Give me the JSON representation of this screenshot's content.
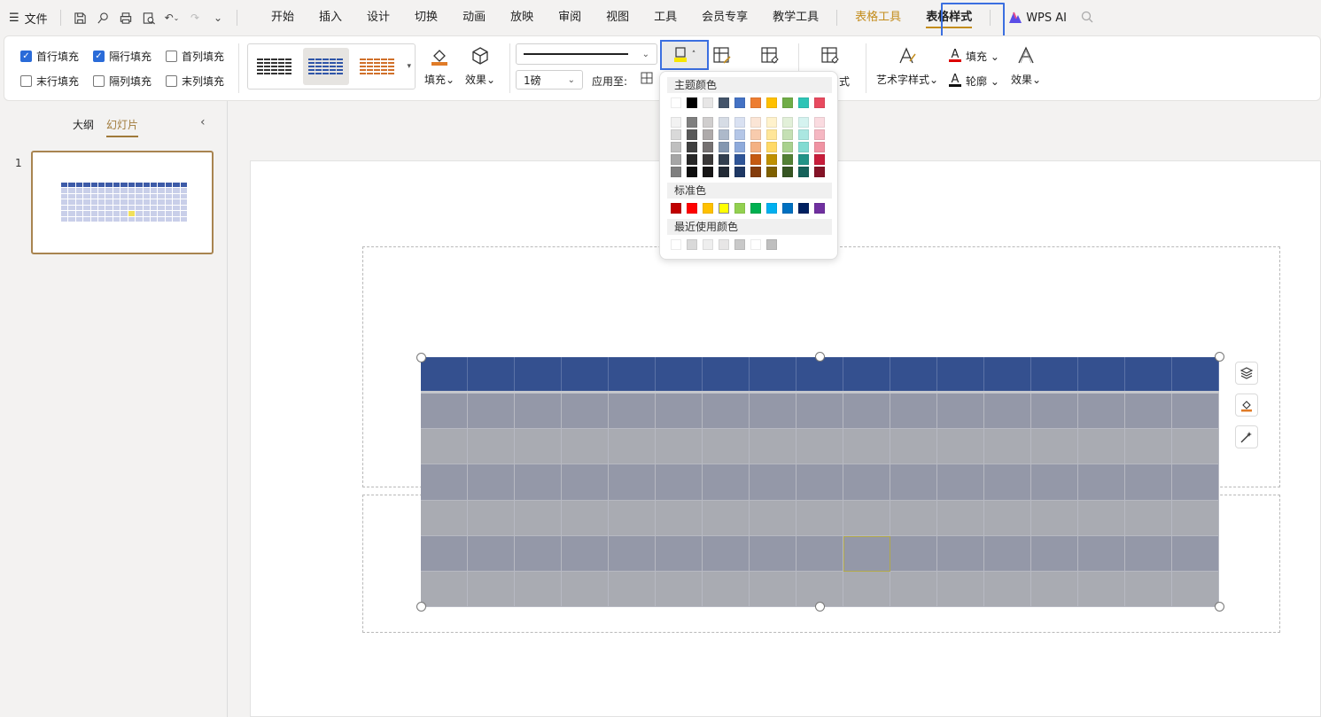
{
  "menu": {
    "file_label": "文件",
    "tabs": [
      "开始",
      "插入",
      "设计",
      "切换",
      "动画",
      "放映",
      "审阅",
      "视图",
      "工具",
      "会员专享",
      "教学工具"
    ],
    "context_tabs": [
      "表格工具",
      "表格样式"
    ],
    "active_tab": "表格样式",
    "wps_ai_label": "WPS AI"
  },
  "ribbon": {
    "checkboxes": [
      {
        "label": "首行填充",
        "checked": true
      },
      {
        "label": "隔行填充",
        "checked": true
      },
      {
        "label": "首列填充",
        "checked": false
      },
      {
        "label": "末行填充",
        "checked": false
      },
      {
        "label": "隔列填充",
        "checked": false
      },
      {
        "label": "末列填充",
        "checked": false
      }
    ],
    "fill_label": "填充",
    "effect_label": "效果",
    "line_weight": "1磅",
    "apply_to_label": "应用至:",
    "partial_style_label": "式",
    "art_text_label": "艺术字样式",
    "text_fill_label": "填充",
    "text_outline_label": "轮廓",
    "text_effect_label": "效果"
  },
  "left_panel": {
    "tab_outline": "大纲",
    "tab_slides": "幻灯片",
    "slide_number": "1"
  },
  "color_popup": {
    "theme_header": "主题颜色",
    "standard_header": "标准色",
    "recent_header": "最近使用颜色",
    "theme_row": [
      "#ffffff",
      "#000000",
      "#e7e6e6",
      "#44546a",
      "#4472c4",
      "#ed7d31",
      "#ffc000",
      "#70ad47",
      "#2ec4b6",
      "#e84a5f"
    ],
    "theme_shades": [
      [
        "#f2f2f2",
        "#7f7f7f",
        "#d0cece",
        "#d6dce5",
        "#d9e1f2",
        "#fbe5d6",
        "#fff2cc",
        "#e2f0d9",
        "#d5f3f0",
        "#fadbe0"
      ],
      [
        "#d9d9d9",
        "#595959",
        "#aeaaaa",
        "#adb9ca",
        "#b4c6e7",
        "#f8cbad",
        "#ffe699",
        "#c5e0b4",
        "#abe7e1",
        "#f5b7c2"
      ],
      [
        "#bfbfbf",
        "#3f3f3f",
        "#757171",
        "#8497b0",
        "#8eaadb",
        "#f4b183",
        "#ffd966",
        "#a9d18e",
        "#82dbd2",
        "#f093a3"
      ],
      [
        "#a6a6a6",
        "#262626",
        "#3a3838",
        "#323f4f",
        "#2f5597",
        "#c55a11",
        "#bf9000",
        "#538135",
        "#229387",
        "#c81d3b"
      ],
      [
        "#7f7f7f",
        "#0d0d0d",
        "#171616",
        "#222a35",
        "#1f3864",
        "#843c0c",
        "#7f6000",
        "#375623",
        "#16625a",
        "#851327"
      ]
    ],
    "standard": [
      "#c00000",
      "#ff0000",
      "#ffc000",
      "#ffff00",
      "#92d050",
      "#00b050",
      "#00b0f0",
      "#0070c0",
      "#002060",
      "#7030a0"
    ],
    "recent": [
      "#ffffff",
      "#d9d9d9",
      "#eeeeee",
      "#e7e6e6",
      "#c9c9c9",
      "#ffffff",
      "#bfbfbf"
    ]
  },
  "colors": {
    "accent": "#3b6fe0",
    "tool_tab": "#c38c1c",
    "table_header": "#34508f",
    "table_row_a": "#9498a8",
    "table_row_b": "#a9abb2"
  }
}
